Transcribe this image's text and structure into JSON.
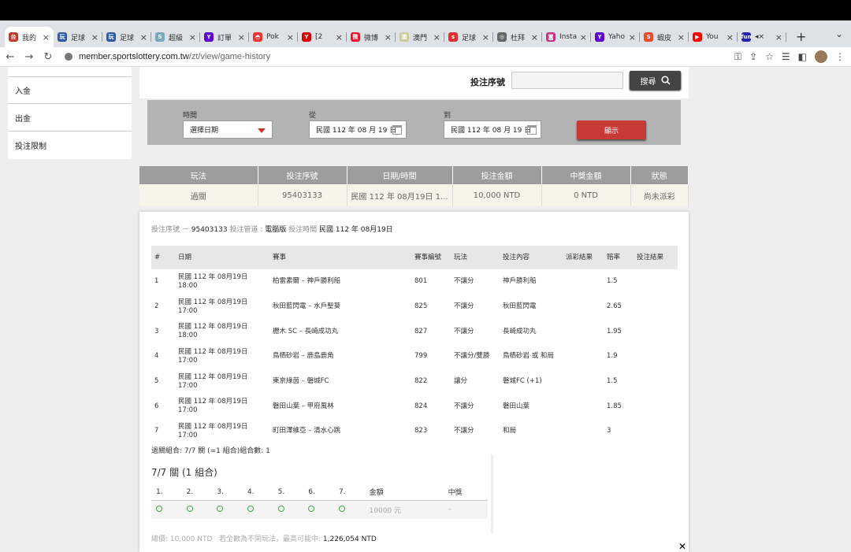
{
  "browser": {
    "tabs": [
      {
        "title": "我的",
        "color": "#c0392b",
        "glyph": "台"
      },
      {
        "title": "足球",
        "color": "#2c5aa0",
        "glyph": "玩"
      },
      {
        "title": "足球",
        "color": "#2c5aa0",
        "glyph": "玩"
      },
      {
        "title": "超級",
        "color": "#7ab",
        "glyph": "S"
      },
      {
        "title": "訂單",
        "color": "#6001d2",
        "glyph": "Y"
      },
      {
        "title": "Pok",
        "color": "#e33",
        "glyph": "◓"
      },
      {
        "title": "[2",
        "color": "#d00",
        "glyph": "Y"
      },
      {
        "title": "微博",
        "color": "#e6162d",
        "glyph": "微"
      },
      {
        "title": "澳門",
        "color": "#cc9",
        "glyph": "澳"
      },
      {
        "title": "足球",
        "color": "#d33",
        "glyph": "s"
      },
      {
        "title": "杜拜",
        "color": "#666",
        "glyph": "◎"
      },
      {
        "title": "Insta",
        "color": "#c13584",
        "glyph": "◙"
      },
      {
        "title": "Yaho",
        "color": "#6001d2",
        "glyph": "Y"
      },
      {
        "title": "蝦皮",
        "color": "#ee4d2d",
        "glyph": "S"
      },
      {
        "title": "You",
        "color": "#f00",
        "glyph": "▶"
      },
      {
        "title": "◂×",
        "color": "#22a",
        "glyph": "fun"
      }
    ],
    "new_tab": "+",
    "url_host": "member.sportslottery.com.tw",
    "url_path": "/zt/view/game-history"
  },
  "sidebar": {
    "items": [
      "入金",
      "出金",
      "投注限制"
    ]
  },
  "search": {
    "label": "投注序號",
    "button": "搜尋"
  },
  "filter": {
    "time_label": "時間",
    "time_value": "選擇日期",
    "from_label": "從",
    "from_value": "民國 112 年 08 月 19 日",
    "to_label": "到",
    "to_value": "民國 112 年 08 月 19 日",
    "show_button": "顯示"
  },
  "summary": {
    "headers": [
      "玩法",
      "投注序號",
      "日期/時間",
      "投注金額",
      "中獎金額",
      "狀態"
    ],
    "row": [
      "過關",
      "95403133",
      "民國 112 年 08月19日 1...",
      "10,000 NTD",
      "0 NTD",
      "尚未派彩"
    ]
  },
  "detail": {
    "serial_label": "投注序號 －",
    "serial": "95403133",
    "channel_label": "投注管道 :",
    "channel": "電腦版",
    "time_label": "投注時間",
    "time": "民國 112 年 08月19日",
    "headers": [
      "#",
      "日期",
      "賽事",
      "賽事編號",
      "玩法",
      "投注內容",
      "派彩結果",
      "賠率",
      "投注結果"
    ],
    "legs": [
      [
        "1",
        "民國 112 年 08月19日 18:00",
        "柏雷素爾 – 神戶勝利船",
        "801",
        "不讓分",
        "神戶勝利船",
        "",
        "1.5",
        ""
      ],
      [
        "2",
        "民國 112 年 08月19日 17:00",
        "秋田藍閃電 – 水戶聖葵",
        "825",
        "不讓分",
        "秋田藍閃電",
        "",
        "2.65",
        ""
      ],
      [
        "3",
        "民國 112 年 08月19日 18:00",
        "櫪木 SC – 長崎成功丸",
        "827",
        "不讓分",
        "長崎成功丸",
        "",
        "1.95",
        ""
      ],
      [
        "4",
        "民國 112 年 08月19日 17:00",
        "鳥栖砂岩 – 鹿島鹿角",
        "799",
        "不讓分/雙勝",
        "鳥栖砂岩 或 和局",
        "",
        "1.9",
        ""
      ],
      [
        "5",
        "民國 112 年 08月19日 17:00",
        "東京綠茵 – 磐城FC",
        "822",
        "讓分",
        "磐城FC (+1)",
        "",
        "1.5",
        ""
      ],
      [
        "6",
        "民國 112 年 08月19日 17:00",
        "磐田山葉 – 甲府風林",
        "824",
        "不讓分",
        "磐田山葉",
        "",
        "1.85",
        ""
      ],
      [
        "7",
        "民國 112 年 08月19日 17:00",
        "町田澤維亞 – 清水心跳",
        "823",
        "不讓分",
        "和局",
        "",
        "3",
        ""
      ]
    ],
    "combo_summary": "過關組合: 7/7 關 (=1 組合)組合數: 1",
    "combo_title": "7/7 關 (1 組合)",
    "combo_headers": [
      "1.",
      "2.",
      "3.",
      "4.",
      "5.",
      "6.",
      "7.",
      "金額",
      "中獎"
    ],
    "combo_amount": "10000 元",
    "combo_win": "–",
    "total_label": "總價: 10,000 NTD",
    "max_label": "若全數為不同玩法，最高可能中:",
    "max_value": "1,226,054 NTD"
  }
}
